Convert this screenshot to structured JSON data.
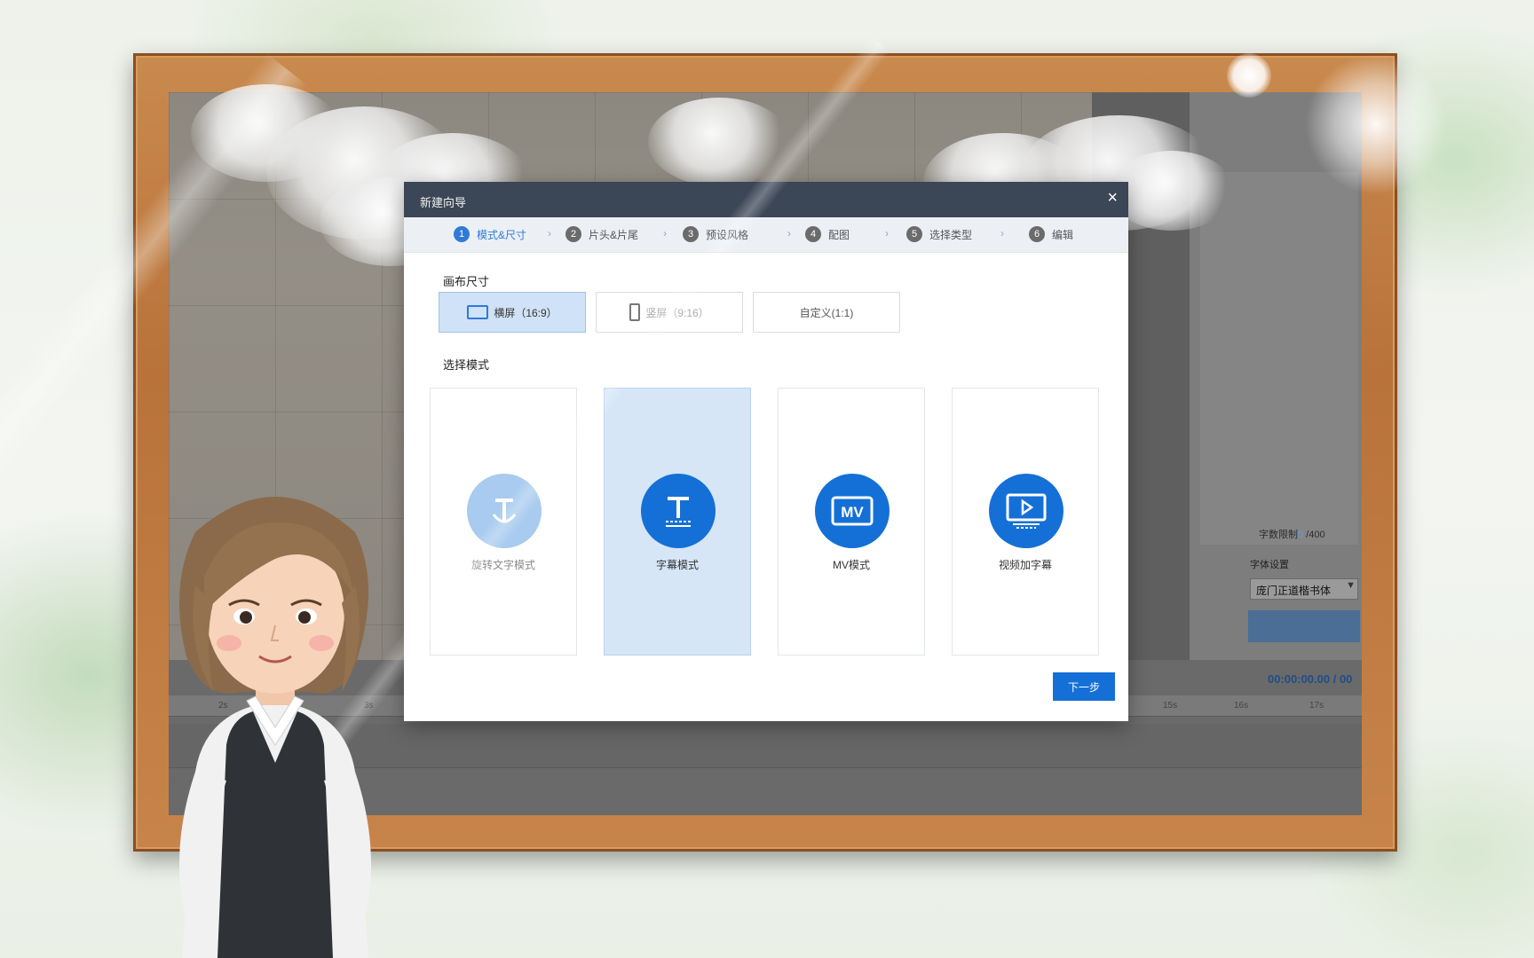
{
  "dialog": {
    "title": "新建向导",
    "close_icon": "×",
    "next_label": "下一步"
  },
  "steps": [
    {
      "num": "1",
      "label": "模式&尺寸",
      "active": true
    },
    {
      "num": "2",
      "label": "片头&片尾",
      "active": false
    },
    {
      "num": "3",
      "label": "预设风格",
      "active": false
    },
    {
      "num": "4",
      "label": "配图",
      "active": false
    },
    {
      "num": "5",
      "label": "选择类型",
      "active": false
    },
    {
      "num": "6",
      "label": "编辑",
      "active": false
    }
  ],
  "canvas_size": {
    "label": "画布尺寸",
    "options": [
      {
        "label": "横屏（16:9）",
        "selected": true
      },
      {
        "label": "竖屏（9:16）",
        "selected": false
      },
      {
        "label": "自定义(1:1)",
        "selected": false
      }
    ]
  },
  "mode": {
    "label": "选择模式",
    "options": [
      {
        "label": "旋转文字模式",
        "icon": "anchor-text-icon",
        "selected": false
      },
      {
        "label": "字幕模式",
        "icon": "subtitle-t-icon",
        "selected": true
      },
      {
        "label": "MV模式",
        "icon": "mv-icon",
        "selected": false
      },
      {
        "label": "视频加字幕",
        "icon": "video-play-icon",
        "selected": false
      }
    ]
  },
  "background_app": {
    "char_limit_label": "字数限制",
    "char_limit_value": "0",
    "char_limit_max": " /400",
    "font_settings_label": "字体设置",
    "font_value": "庞门正道楷书体",
    "time_display": "00:00:00.00 / 00",
    "ruler_ticks": [
      "2s",
      "3s",
      "15s",
      "16s",
      "17s"
    ]
  },
  "colors": {
    "accent": "#1470d6",
    "dialog_header": "#3b4656",
    "selected_bg": "#d6e6f7",
    "frame_wood": "#c07d43"
  }
}
